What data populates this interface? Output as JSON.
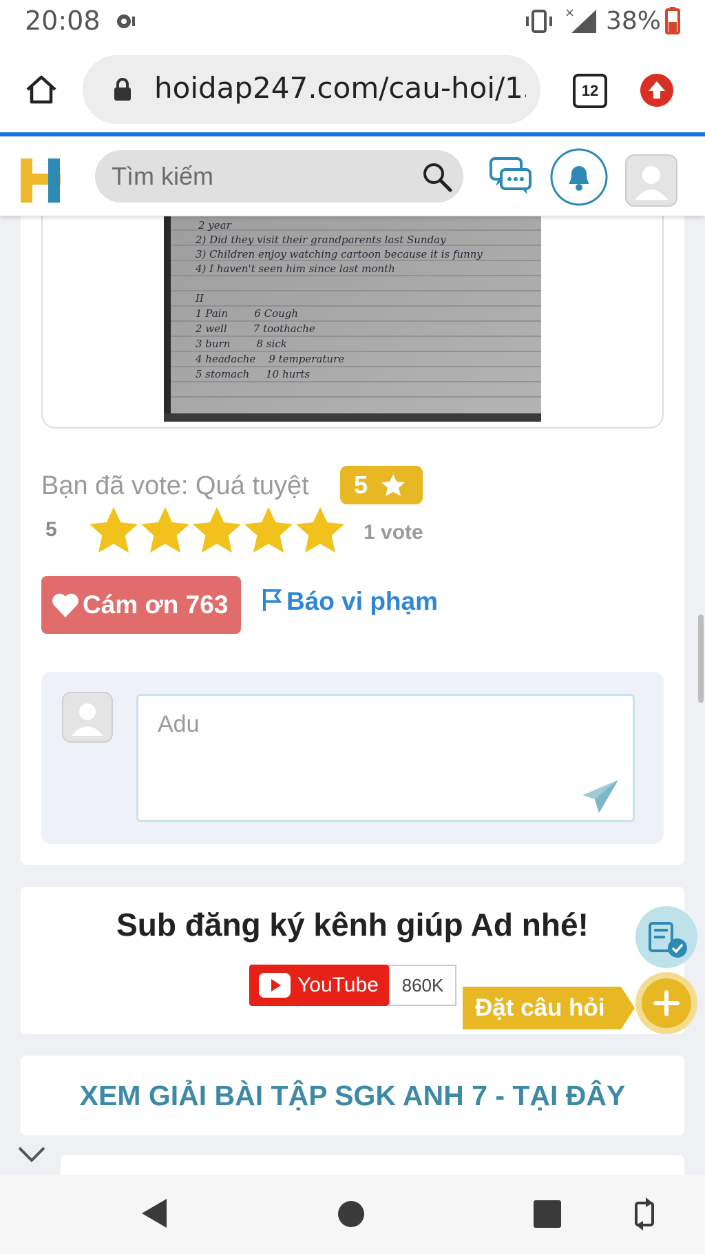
{
  "status_bar": {
    "time": "20:08",
    "battery": "38%"
  },
  "browser": {
    "url": "hoidap247.com/cau-hoi/13",
    "tab_count": "12"
  },
  "site_header": {
    "search_placeholder": "Tìm kiếm"
  },
  "answer_image": {
    "lines": [
      "2 year",
      "2) Did they visit their grandparents last Sunday",
      "3) Children enjoy watching cartoon because it is funny",
      "4) I haven't seen him since last month",
      "II",
      "1 Pain        6 Cough",
      "2 well        7 toothache",
      "3 burn        8 sick",
      "4 headache    9 temperature",
      "5 stomach     10 hurts"
    ]
  },
  "rating": {
    "vote_text": "Bạn đã vote: Quá tuyệt",
    "vote_badge": "5",
    "average": "5",
    "stars_filled": 5,
    "stars_total": 5,
    "count": "1 vote",
    "star_color": "#f1c21b"
  },
  "actions": {
    "thanks_label": "Cám ơn 763",
    "report_label": "Báo vi phạm"
  },
  "comment": {
    "value": "Adu"
  },
  "promo": {
    "title": "Sub đăng ký kênh giúp Ad nhé!",
    "youtube_label": "YouTube",
    "youtube_count": "860K"
  },
  "fab": {
    "ask_label": "Đặt câu hỏi"
  },
  "link_banner": {
    "label": "XEM GIẢI BÀI TẬP SGK ANH 7 - TẠI ĐÂY"
  }
}
